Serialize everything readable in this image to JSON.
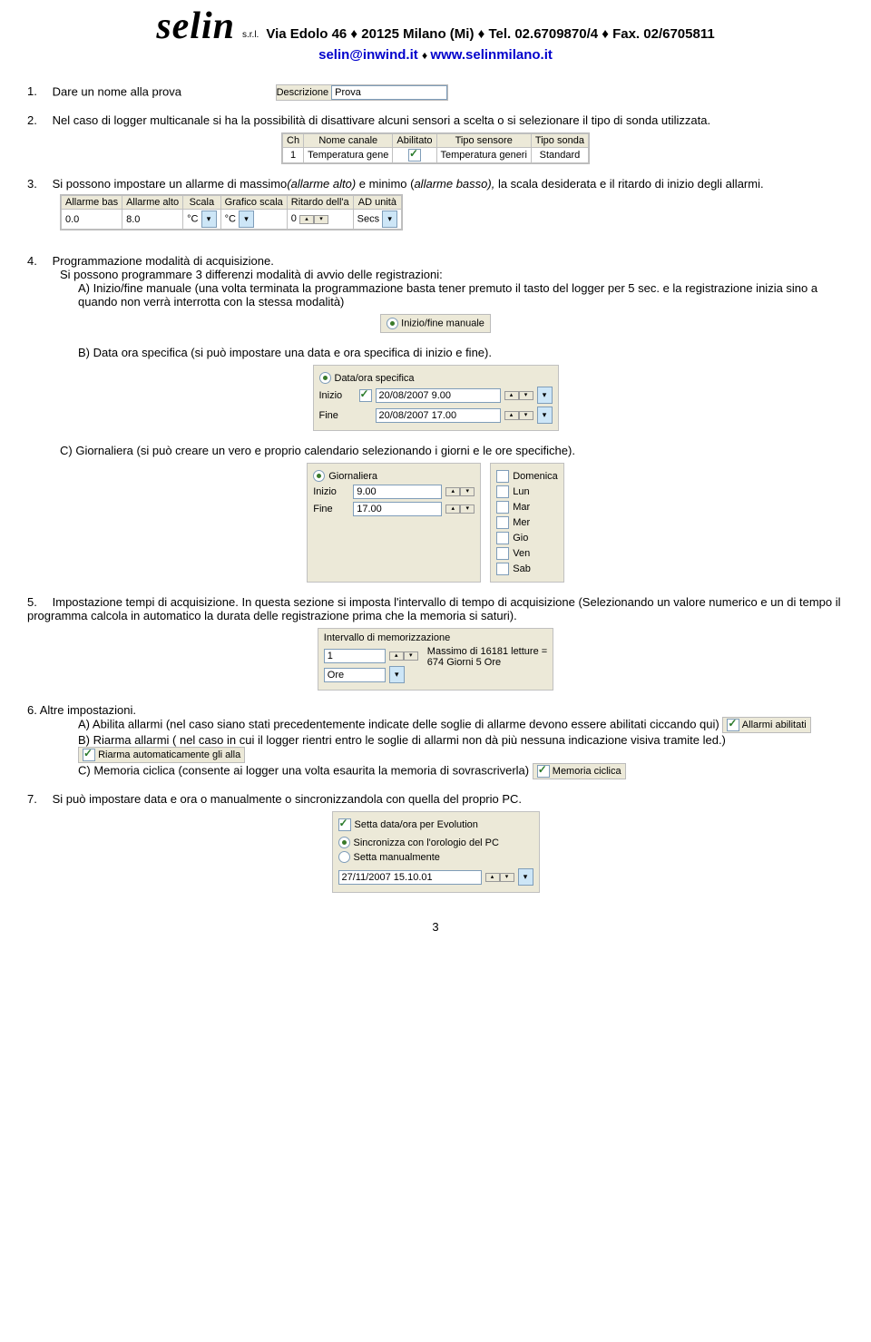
{
  "header": {
    "brand": "selin",
    "srl": "s.r.l.",
    "address": "Via Edolo 46 ♦ 20125 Milano (Mi) ♦ Tel. 02.6709870/4 ♦ Fax. 02/6705811",
    "email": "selin@inwind.it",
    "web": "www.selinmilano.it"
  },
  "items": {
    "n1": {
      "num": "1.",
      "text": "Dare un nome alla prova"
    },
    "descField": {
      "label": "Descrizione",
      "value": "Prova"
    },
    "n2": {
      "num": "2.",
      "text": "Nel caso di logger multicanale si ha la possibilità di disattivare alcuni sensori a scelta o si selezionare il tipo di sonda utilizzata."
    },
    "chTable": {
      "headers": [
        "Ch",
        "Nome canale",
        "Abilitato",
        "Tipo sensore",
        "Tipo sonda"
      ],
      "row": [
        "1",
        "Temperatura gene",
        "✓",
        "Temperatura generi",
        "Standard"
      ]
    },
    "n3": {
      "num": "3.",
      "text_a": "Si possono impostare un allarme di massimo",
      "text_b": "(allarme alto)",
      "text_c": " e minimo (",
      "text_d": "allarme basso),",
      "text_e": " la scala desiderata e il ritardo di inizio degli allarmi."
    },
    "alarmTable": {
      "headers": [
        "Allarme bas",
        "Allarme alto",
        "Scala",
        "Grafico scala",
        "Ritardo dell'a",
        "AD unità"
      ],
      "row": [
        "0.0",
        "8.0",
        "°C",
        "°C",
        "0",
        "Secs"
      ]
    },
    "n4": {
      "num": "4.",
      "text": "Programmazione modalità di acquisizione.",
      "sub": "Si possono programmare 3 differenzi modalità di avvio delle registrazioni:",
      "a_label": "A)",
      "a_text": "Inizio/fine manuale (una volta terminata la programmazione basta tener premuto il tasto del logger per 5 sec. e la registrazione inizia sino a quando non verrà interrotta con la stessa modalità)",
      "radio_manual": "Inizio/fine manuale",
      "b_label": "B)",
      "b_text": "Data ora specifica (si può impostare una data e ora specifica di inizio e fine).",
      "radio_specific": "Data/ora specifica",
      "inizio_label": "Inizio",
      "inizio_val": "20/08/2007 9.00",
      "fine_label": "Fine",
      "fine_val": "20/08/2007 17.00",
      "c_text": "C) Giornaliera (si può creare un vero e proprio calendario selezionando i giorni e le ore specifiche).",
      "radio_daily": "Giornaliera",
      "g_inizio": "Inizio",
      "g_inizio_val": "9.00",
      "g_fine": "Fine",
      "g_fine_val": "17.00",
      "days": [
        "Domenica",
        "Lun",
        "Mar",
        "Mer",
        "Gio",
        "Ven",
        "Sab"
      ]
    },
    "n5": {
      "num": "5.",
      "text": "Impostazione tempi di acquisizione. In questa sezione si imposta l'intervallo di tempo di acquisizione (Selezionando un valore numerico e un di tempo il programma calcola in automatico la durata delle registrazione  prima che la memoria si saturi).",
      "group_label": "Intervallo di memorizzazione",
      "interval_val": "1",
      "unit": "Ore",
      "maxline1": "Massimo di 16181 letture =",
      "maxline2": "674 Giorni 5 Ore"
    },
    "n6": {
      "num": "6.",
      "text": "Altre impostazioni.",
      "a_label": "A)",
      "a_text1": "Abilita allarmi (nel caso siano stati precedentemente indicate delle soglie di allarme devono essere abilitati ciccando qui) ",
      "a_chk": "Allarmi abilitati",
      "b_label": "B)",
      "b_text": "Riarma allarmi ( nel caso in cui il logger rientri entro le soglie di allarmi non dà più nessuna indicazione visiva tramite led.) ",
      "b_chk": "Riarma automaticamente gli alla",
      "c_label": "C)",
      "c_text": "Memoria ciclica (consente ai logger una volta esaurita la memoria di sovrascriverla) ",
      "c_chk": "Memoria ciclica"
    },
    "n7": {
      "num": "7.",
      "text": "Si può impostare data e ora o manualmente o sincronizzandola con quella del proprio PC.",
      "chk_label": "Setta data/ora per Evolution",
      "r1": "Sincronizza con l'orologio del PC",
      "r2": "Setta manualmente",
      "dt": "27/11/2007 15.10.01"
    }
  },
  "page_num": "3"
}
